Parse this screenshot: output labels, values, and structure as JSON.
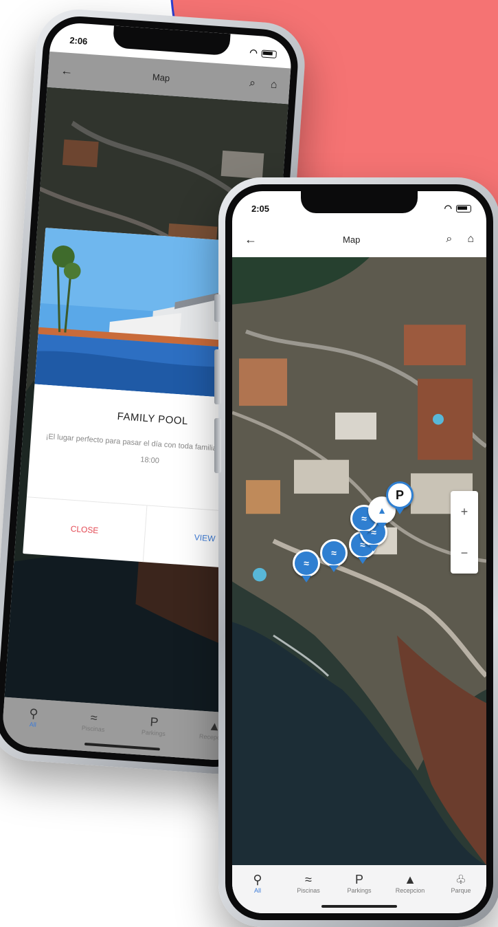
{
  "colors": {
    "background_coral": "#f57373",
    "accent_blue": "#3b7bd8",
    "close_red": "#e44b55",
    "pin_blue": "#2f7fd1"
  },
  "phone_back": {
    "status_time": "2:06",
    "appbar": {
      "title": "Map",
      "back_icon": "arrow-left-icon",
      "search_icon": "search-icon",
      "home_icon": "home-icon"
    },
    "popup": {
      "title": "FAMILY POOL",
      "description": "¡El lugar perfecto para pasar el día con toda familia! 🕓 10:00 - 18:00",
      "close_label": "CLOSE",
      "view_label": "VIEW"
    },
    "tabs": [
      {
        "label": "All",
        "icon": "map-pin-icon",
        "active": true
      },
      {
        "label": "Piscinas",
        "icon": "pool-icon",
        "active": false
      },
      {
        "label": "Parkings",
        "icon": "parking-icon",
        "active": false
      },
      {
        "label": "Recepcion",
        "icon": "reception-icon",
        "active": false
      }
    ]
  },
  "phone_front": {
    "status_time": "2:05",
    "appbar": {
      "title": "Map",
      "back_icon": "arrow-left-icon",
      "search_icon": "search-icon",
      "home_icon": "home-icon"
    },
    "zoom": {
      "in": "+",
      "out": "−"
    },
    "pins": [
      {
        "type": "pool",
        "icon": "pool-pin-icon"
      },
      {
        "type": "pool",
        "icon": "pool-pin-icon"
      },
      {
        "type": "pool",
        "icon": "pool-pin-icon"
      },
      {
        "type": "pool",
        "icon": "pool-pin-icon"
      },
      {
        "type": "pool",
        "icon": "pool-pin-icon"
      },
      {
        "type": "reception",
        "icon": "reception-pin-icon"
      },
      {
        "type": "parking",
        "icon": "parking-pin-icon",
        "label": "P"
      }
    ],
    "tabs": [
      {
        "label": "All",
        "icon": "map-pin-icon",
        "active": true
      },
      {
        "label": "Piscinas",
        "icon": "pool-icon",
        "active": false
      },
      {
        "label": "Parkings",
        "icon": "parking-icon",
        "active": false
      },
      {
        "label": "Recepcion",
        "icon": "reception-icon",
        "active": false
      },
      {
        "label": "Parque",
        "icon": "park-icon",
        "active": false
      }
    ]
  }
}
